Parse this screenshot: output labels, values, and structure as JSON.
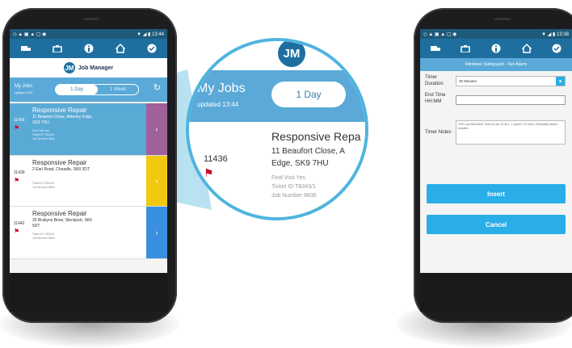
{
  "status": {
    "left_icons": "◇ ▲ ▣ ▲ ▢ ◉",
    "right": "▼ ◢ ▮ 13:44",
    "right_b": "▼ ◢ ▮ 13:38"
  },
  "toolbar_icons": [
    "truck-icon",
    "briefcase-icon",
    "info-icon",
    "home-icon",
    "check-icon"
  ],
  "brand": {
    "logo": "JM",
    "name": "Job Manager"
  },
  "jobs_header": {
    "title": "My Jobs",
    "updated": "updated 13:44",
    "tab_1day": "1 Day",
    "tab_2": "1 Week",
    "zoom_title": "My Jobs",
    "zoom_updated": "updated 13:44"
  },
  "jobs": [
    {
      "number": "11436",
      "title": "Responsive Repair",
      "address": "11 Beaufort Close, Alderley Edge, SK9 7HU",
      "meta1": "Find Visit Yes",
      "meta2": "Ticket ID T8343/1",
      "meta3": "Job Number 8836",
      "color": "#a0609a"
    },
    {
      "number": "11439",
      "title": "Responsive Repair",
      "address": "2 Earl Road, Cheadle, SK8 3DT",
      "meta1": "Ticket ID T8343/1",
      "meta2": "Job Number 8863",
      "meta3": "",
      "color": "#f2c811"
    },
    {
      "number": "11442",
      "title": "Responsive Repair",
      "address": "26 Brabyns Brow, Stockport, SK6 5DT",
      "meta1": "Ticket ID T8343/1",
      "meta2": "Job Number 8863",
      "meta3": "",
      "color": "#3b8fe0"
    }
  ],
  "zoom": {
    "number": "11436",
    "title": "Responsive Repa",
    "addr1": "11 Beaufort Close, A",
    "addr2": "Edge, SK9 7HU",
    "meta1": "Find Visit Yes",
    "meta2": "Ticket ID T8343/1",
    "meta3": "Job Number 8836",
    "tab": "1 Day",
    "logo": "JM"
  },
  "alarm": {
    "title": "Wireless Safeguard - Set Alarm",
    "timer_duration_label": "Timer Duration",
    "timer_duration_value": "30 Minutes",
    "end_time_label": "End Time HH:MM",
    "end_time_value": "",
    "notes_label": "Timer Notes",
    "notes_value": "GPS Last Recorded Time 06-Jan 10:36 (...) Speed: 0.2 km/h; Potentially violent resident",
    "insert_label": "Insert",
    "cancel_label": "Cancel"
  }
}
